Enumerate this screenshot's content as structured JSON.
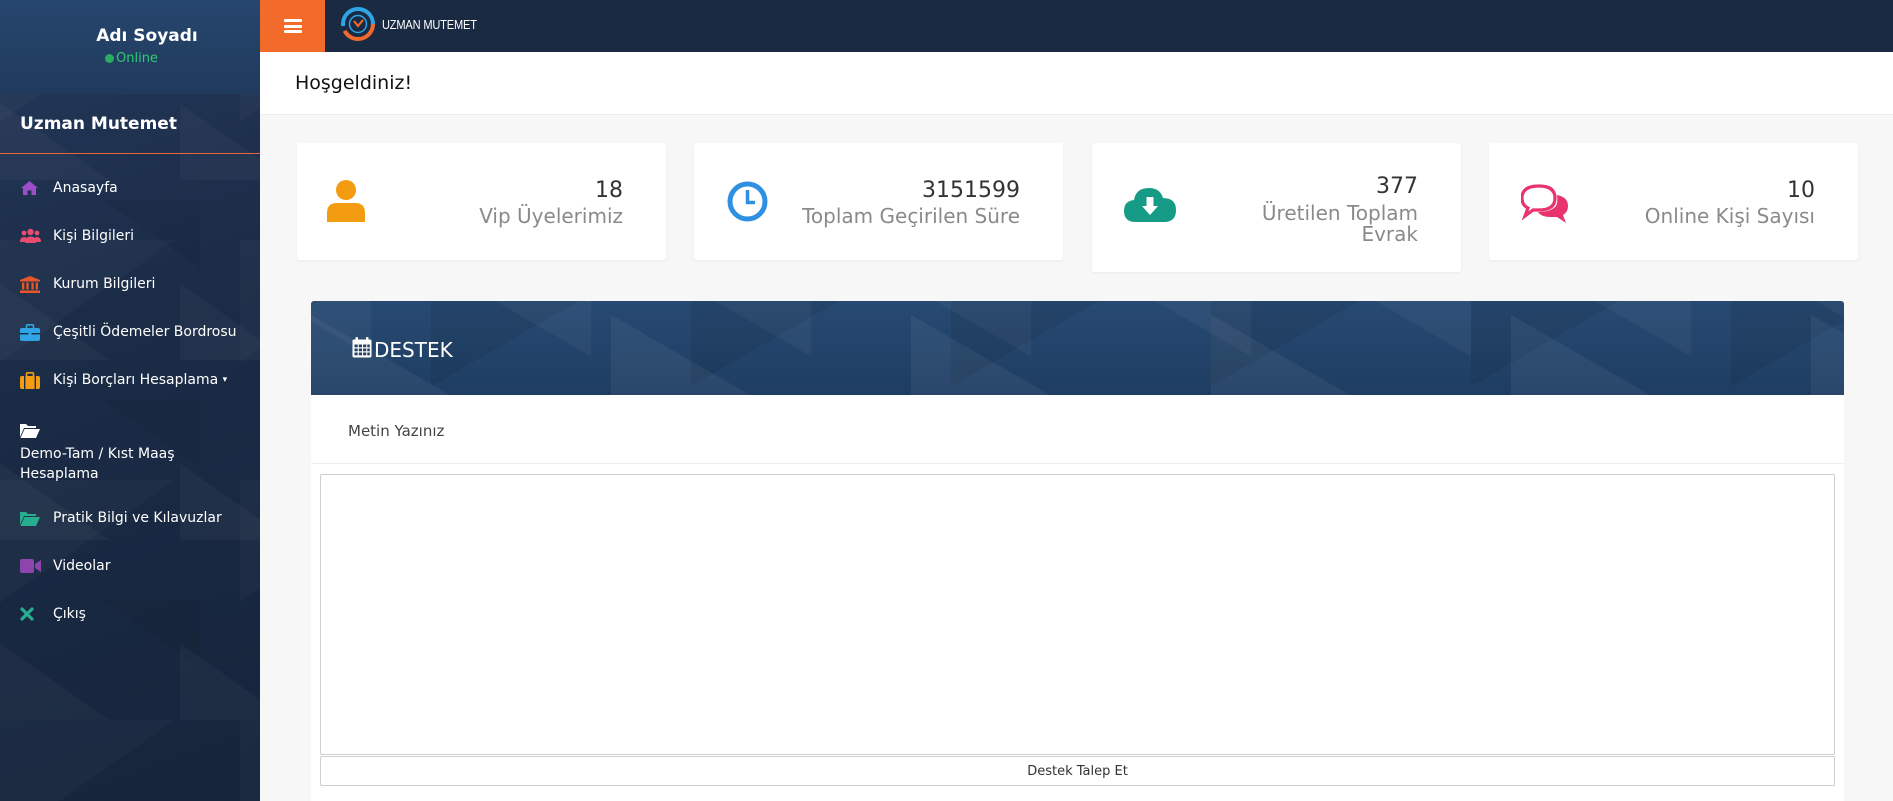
{
  "user": {
    "name": "Adı Soyadı",
    "status": "Online"
  },
  "sidebar": {
    "brand": "Uzman Mutemet",
    "items": [
      {
        "label": "Anasayfa",
        "icon": "home-icon",
        "color": "#9b4dca"
      },
      {
        "label": "Kişi Bilgileri",
        "icon": "users-icon",
        "color": "#e84c6e"
      },
      {
        "label": "Kurum Bilgileri",
        "icon": "institution-icon",
        "color": "#e8562a"
      },
      {
        "label": "Çeşitli Ödemeler Bordrosu",
        "icon": "briefcase-icon",
        "color": "#2fa5e6"
      },
      {
        "label": "Kişi Borçları Hesaplama",
        "icon": "suitcase-icon",
        "color": "#f39c12"
      },
      {
        "label": "Demo-Tam / Kıst Maaş Hesaplama",
        "icon": "folder-open-icon",
        "color": "#ffffff"
      },
      {
        "label": "Pratik Bilgi ve Kılavuzlar",
        "icon": "folder-open-icon",
        "color": "#27ae8f"
      },
      {
        "label": "Videolar",
        "icon": "video-icon",
        "color": "#8e44ad"
      },
      {
        "label": "Çıkış",
        "icon": "close-icon",
        "color": "#27ae8f"
      }
    ]
  },
  "topbar": {
    "logo_text": "UZMAN MUTEMET"
  },
  "welcome": {
    "title": "Hoşgeldiniz!"
  },
  "stats": [
    {
      "value": "18",
      "label": "Vip Üyelerimiz",
      "icon": "user-icon",
      "color": "#f39c12"
    },
    {
      "value": "3151599",
      "label": "Toplam Geçirilen Süre",
      "icon": "clock-icon",
      "color": "#2f8fe0"
    },
    {
      "value": "377",
      "label": "Üretilen Toplam Evrak",
      "icon": "cloud-download-icon",
      "color": "#169c86"
    },
    {
      "value": "10",
      "label": "Online Kişi Sayısı",
      "icon": "comments-icon",
      "color": "#e8336e"
    }
  ],
  "support": {
    "title": "DESTEK",
    "field_label": "Metin Yazınız",
    "textarea_value": "",
    "submit_label": "Destek Talep Et"
  }
}
